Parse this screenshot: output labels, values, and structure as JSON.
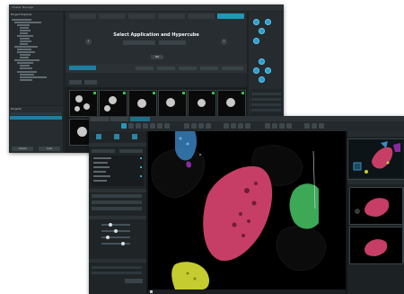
{
  "back_window": {
    "title": "Cluster Manager",
    "project_explorer": {
      "heading": "Project Explorer"
    },
    "projects": {
      "heading": "Projects",
      "buttons": [
        "Unload",
        "Load"
      ]
    },
    "wizard": {
      "headline": "Select Application and Hypercube",
      "ok_label": "OK",
      "prev_symbol": "‹",
      "next_symbol": "›"
    },
    "accent": "#2496b8"
  },
  "front_window": {
    "title": "Cluster Analysis",
    "viewer_colors": {
      "red": "#c63e65",
      "green": "#3da856",
      "yellow": "#c4cc2f",
      "blue": "#3b88c9"
    }
  }
}
